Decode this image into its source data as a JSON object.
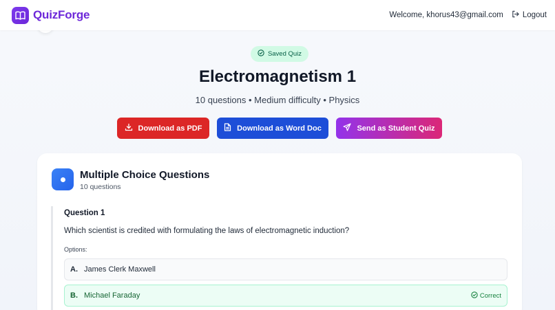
{
  "header": {
    "brand": "QuizForge",
    "welcome": "Welcome, khorus43@gmail.com",
    "logout": "Logout"
  },
  "quiz": {
    "badge": "Saved Quiz",
    "title": "Electromagnetism 1",
    "meta": "10 questions • Medium difficulty • Physics"
  },
  "actions": {
    "pdf": "Download as PDF",
    "word": "Download as Word Doc",
    "send": "Send as Student Quiz"
  },
  "section": {
    "title": "Multiple Choice Questions",
    "count": "10 questions",
    "icon": "circle-dot-icon"
  },
  "question": {
    "label": "Question 1",
    "text": "Which scientist is credited with formulating the laws of electromagnetic induction?",
    "options_label": "Options:",
    "options": [
      {
        "letter": "A.",
        "text": "James Clerk Maxwell",
        "correct": false
      },
      {
        "letter": "B.",
        "text": "Michael Faraday",
        "correct": true
      }
    ],
    "correct_label": "Correct"
  },
  "colors": {
    "brand": "#6d28d9",
    "pdf": "#dc2626",
    "word": "#1d4ed8",
    "send_start": "#9333ea",
    "send_end": "#db2777",
    "correct": "#15803d"
  }
}
